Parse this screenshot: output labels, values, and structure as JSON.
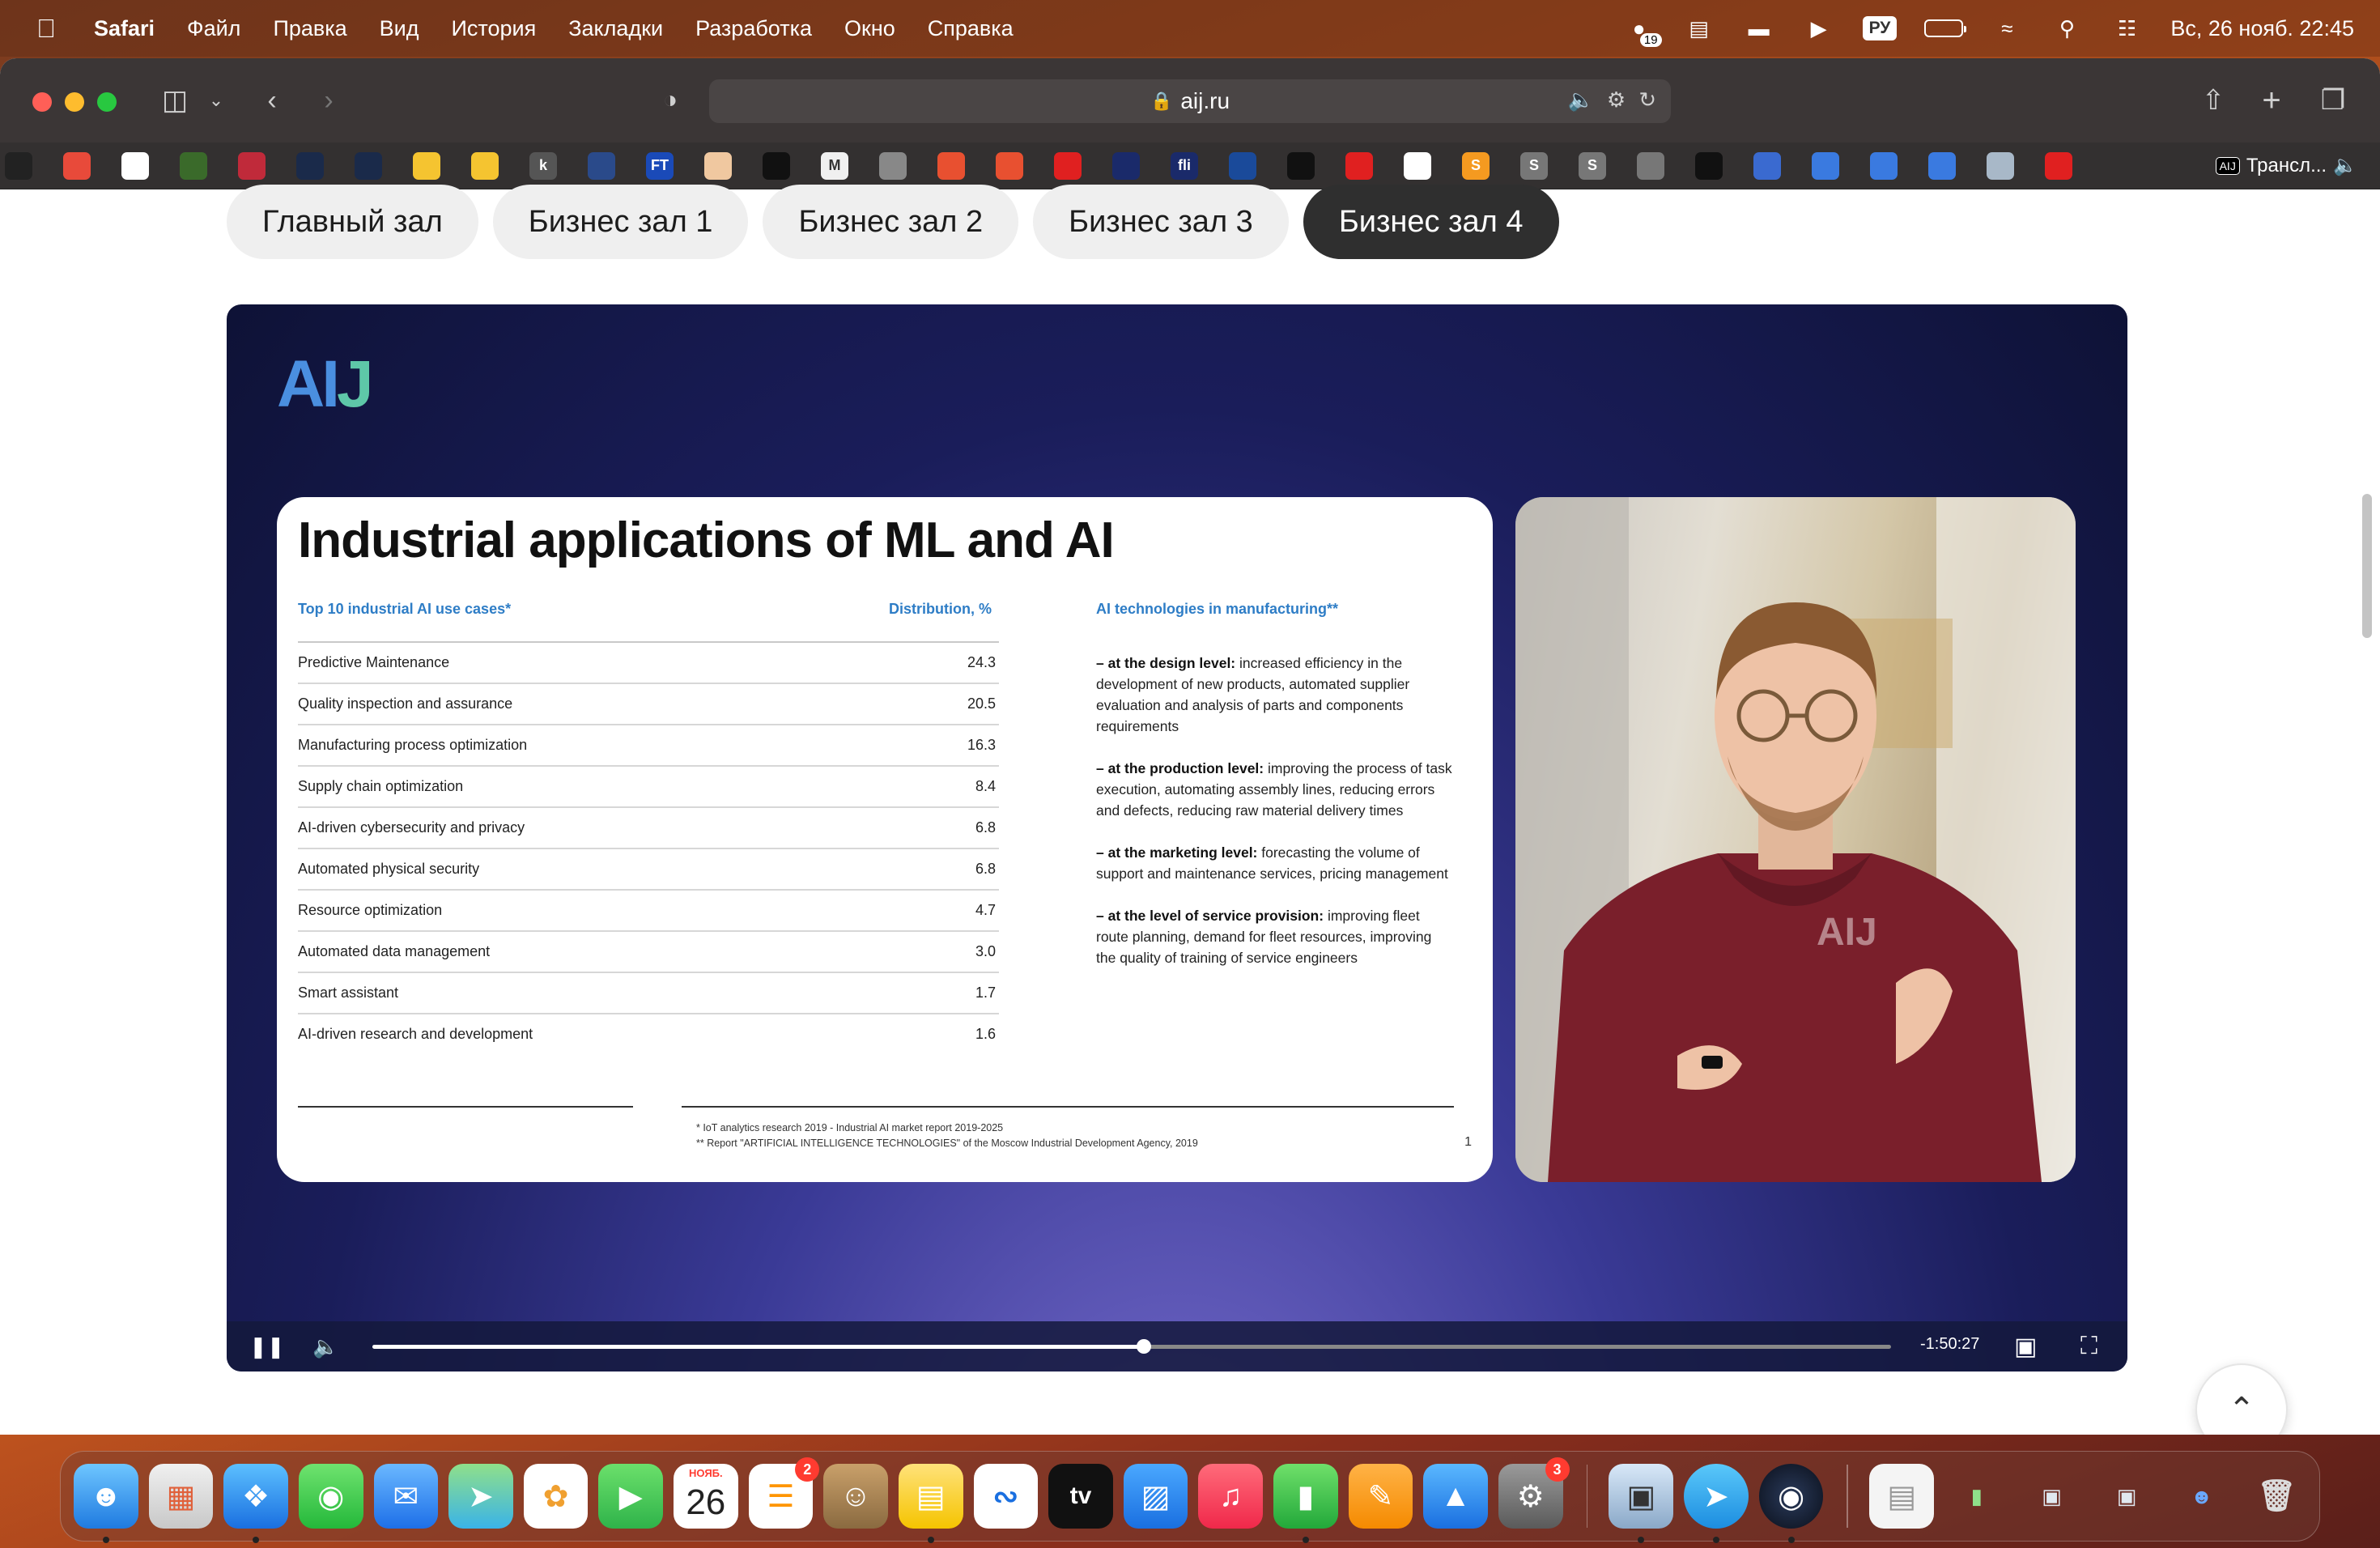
{
  "menubar": {
    "app_name": "Safari",
    "items": [
      "Файл",
      "Правка",
      "Вид",
      "История",
      "Закладки",
      "Разработка",
      "Окно",
      "Справка"
    ],
    "status_badge_count": "19",
    "input_language": "РУ",
    "datetime": "Вс, 26 нояб. 22:45"
  },
  "browser": {
    "url": "aij.ru",
    "translate_label": "Трансл...",
    "translate_badge": "AIJ",
    "favicon_letters": [
      "",
      "",
      "",
      "",
      "",
      "",
      "",
      "",
      "",
      "k",
      "",
      "FT",
      "",
      "",
      "M",
      "",
      "",
      "",
      "",
      "",
      "fli",
      "",
      "",
      "",
      "",
      "S",
      "S",
      "S",
      "",
      "",
      "",
      "",
      "",
      "",
      "",
      ""
    ]
  },
  "hall_tabs": [
    {
      "label": "Главный зал",
      "active": false
    },
    {
      "label": "Бизнес зал 1",
      "active": false
    },
    {
      "label": "Бизнес зал 2",
      "active": false
    },
    {
      "label": "Бизнес зал 3",
      "active": false
    },
    {
      "label": "Бизнес зал 4",
      "active": true
    }
  ],
  "video": {
    "logo_text": "AI",
    "logo_accent": "J",
    "slide": {
      "title": "Industrial applications of ML and AI",
      "left_heading": "Top 10 industrial AI use cases*",
      "value_heading": "Distribution, %",
      "right_heading": "AI technologies in manufacturing**",
      "use_cases": [
        {
          "name": "Predictive Maintenance",
          "value": "24.3"
        },
        {
          "name": "Quality inspection and assurance",
          "value": "20.5"
        },
        {
          "name": "Manufacturing process optimization",
          "value": "16.3"
        },
        {
          "name": "Supply chain optimization",
          "value": "8.4"
        },
        {
          "name": "AI-driven cybersecurity and privacy",
          "value": "6.8"
        },
        {
          "name": "Automated physical security",
          "value": "6.8"
        },
        {
          "name": "Resource optimization",
          "value": "4.7"
        },
        {
          "name": "Automated data management",
          "value": "3.0"
        },
        {
          "name": "Smart assistant",
          "value": "1.7"
        },
        {
          "name": "AI-driven research and development",
          "value": "1.6"
        }
      ],
      "technologies": [
        {
          "lead": "– at the design level:",
          "text": " increased efficiency in the development of new products, automated supplier evaluation and analysis of parts and components requirements"
        },
        {
          "lead": "– at the production level:",
          "text": " improving the process of task execution, automating assembly lines, reducing errors and defects, reducing raw material delivery times"
        },
        {
          "lead": "– at the marketing level:",
          "text": " forecasting the volume of support and maintenance services, pricing management"
        },
        {
          "lead": "– at the level of service provision:",
          "text": " improving fleet route planning, demand for fleet resources, improving the quality of training of service engineers"
        }
      ],
      "footnote_1": "* IoT analytics research 2019 - Industrial AI market report 2019-2025",
      "footnote_2": "** Report \"ARTIFICIAL INTELLIGENCE TECHNOLOGIES\" of the Moscow Industrial Development Agency, 2019",
      "page_number": "1"
    },
    "presenter_hoodie_text": "AIJ",
    "time_remaining": "-1:50:27",
    "progress_fraction": 0.508
  },
  "dock": {
    "calendar_month": "НОЯБ.",
    "calendar_day": "26",
    "tv_label": "tv",
    "reminders_badge": "2",
    "settings_badge": "3"
  },
  "colors": {
    "active_tab_bg": "#2f2f2f",
    "slide_heading_blue": "#2e7dc6",
    "logo_blue": "#4a8fe0",
    "logo_green": "#5ec7a8"
  }
}
